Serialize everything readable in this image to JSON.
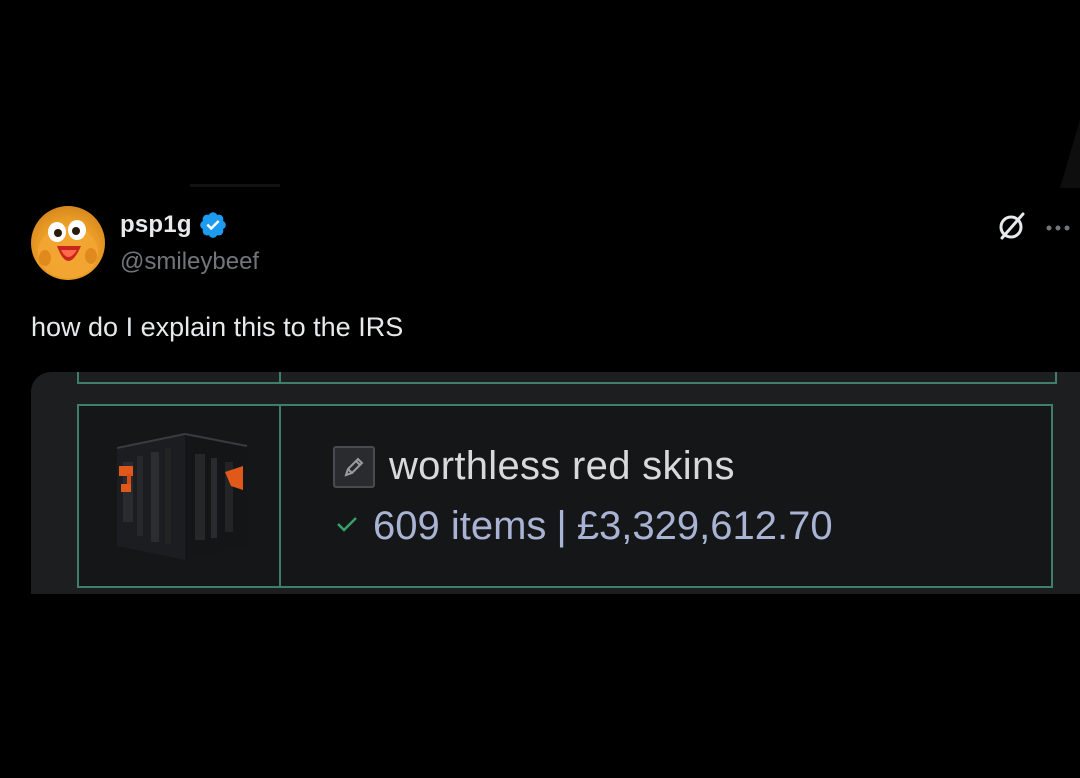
{
  "tweet": {
    "display_name": "psp1g",
    "handle": "@smileybeef",
    "text": "how do I explain this to the IRS",
    "verified": true
  },
  "icons": {
    "verified": "verified-badge-icon",
    "grok": "grok-icon",
    "more": "more-options-icon",
    "edit": "pencil-edit-icon",
    "check": "checkmark-icon"
  },
  "media": {
    "storage_name": "worthless red skins",
    "items_count": "609 items",
    "separator": "|",
    "total_value": "£3,329,612.70"
  },
  "colors": {
    "background": "#000000",
    "verified_blue": "#1d9bf0",
    "handle_gray": "#71767b",
    "card_border_green": "#3f7f69",
    "check_green": "#3aa06a",
    "value_text": "#a9b4d4"
  }
}
